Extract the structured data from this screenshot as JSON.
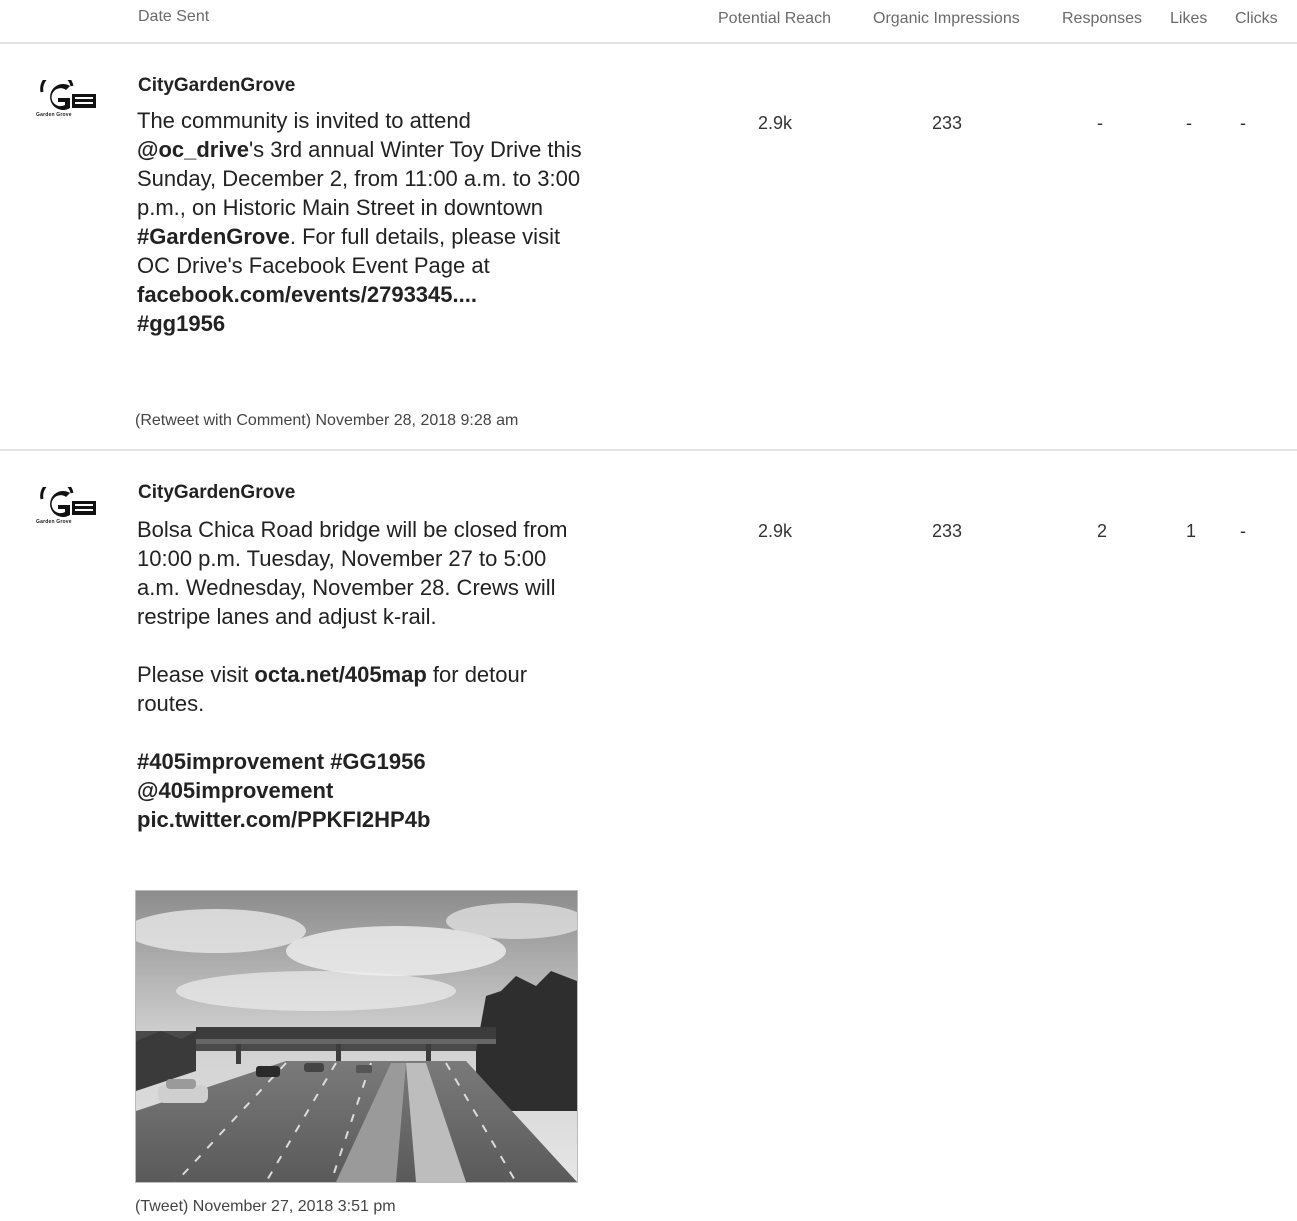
{
  "columns": {
    "date_sent": "Date Sent",
    "potential_reach": "Potential Reach",
    "organic_impressions": "Organic Impressions",
    "responses": "Responses",
    "likes": "Likes",
    "clicks": "Clicks"
  },
  "posts": [
    {
      "author": "CityGardenGrove",
      "logo_text": "Garden Grove",
      "text_segments": [
        "The community is invited to attend ",
        "@oc_drive",
        "'s 3rd annual Winter Toy Drive this Sunday, December 2, from 11:00 a.m. to 3:00 p.m., on Historic Main Street in downtown ",
        "#GardenGrove",
        ". For full details, please visit OC Drive's Facebook Event Page at ",
        "facebook.com/events/2793345....",
        "#gg1956"
      ],
      "type": "(Retweet with Comment)",
      "date": "November 28, 2018 9:28 am",
      "potential_reach": "2.9k",
      "organic_impressions": "233",
      "responses": "-",
      "likes": "-",
      "clicks": "-"
    },
    {
      "author": "CityGardenGrove",
      "logo_text": "Garden Grove",
      "paragraph1": "Bolsa Chica Road bridge will be closed from 10:00 p.m. Tuesday, November 27 to 5:00 a.m. Wednesday, November 28. Crews will restripe lanes and adjust k-rail.",
      "paragraph2_pre": "Please visit ",
      "paragraph2_link": "octa.net/405map",
      "paragraph2_post": " for detour routes.",
      "hashtags_line1": "#405improvement #GG1956",
      "hashtags_line2": "@405improvement",
      "pic_link": "pic.twitter.com/PPKFI2HP4b",
      "type": "(Tweet)",
      "date": "November 27, 2018 3:51 pm",
      "potential_reach": "2.9k",
      "organic_impressions": "233",
      "responses": "2",
      "likes": "1",
      "clicks": "-"
    }
  ]
}
